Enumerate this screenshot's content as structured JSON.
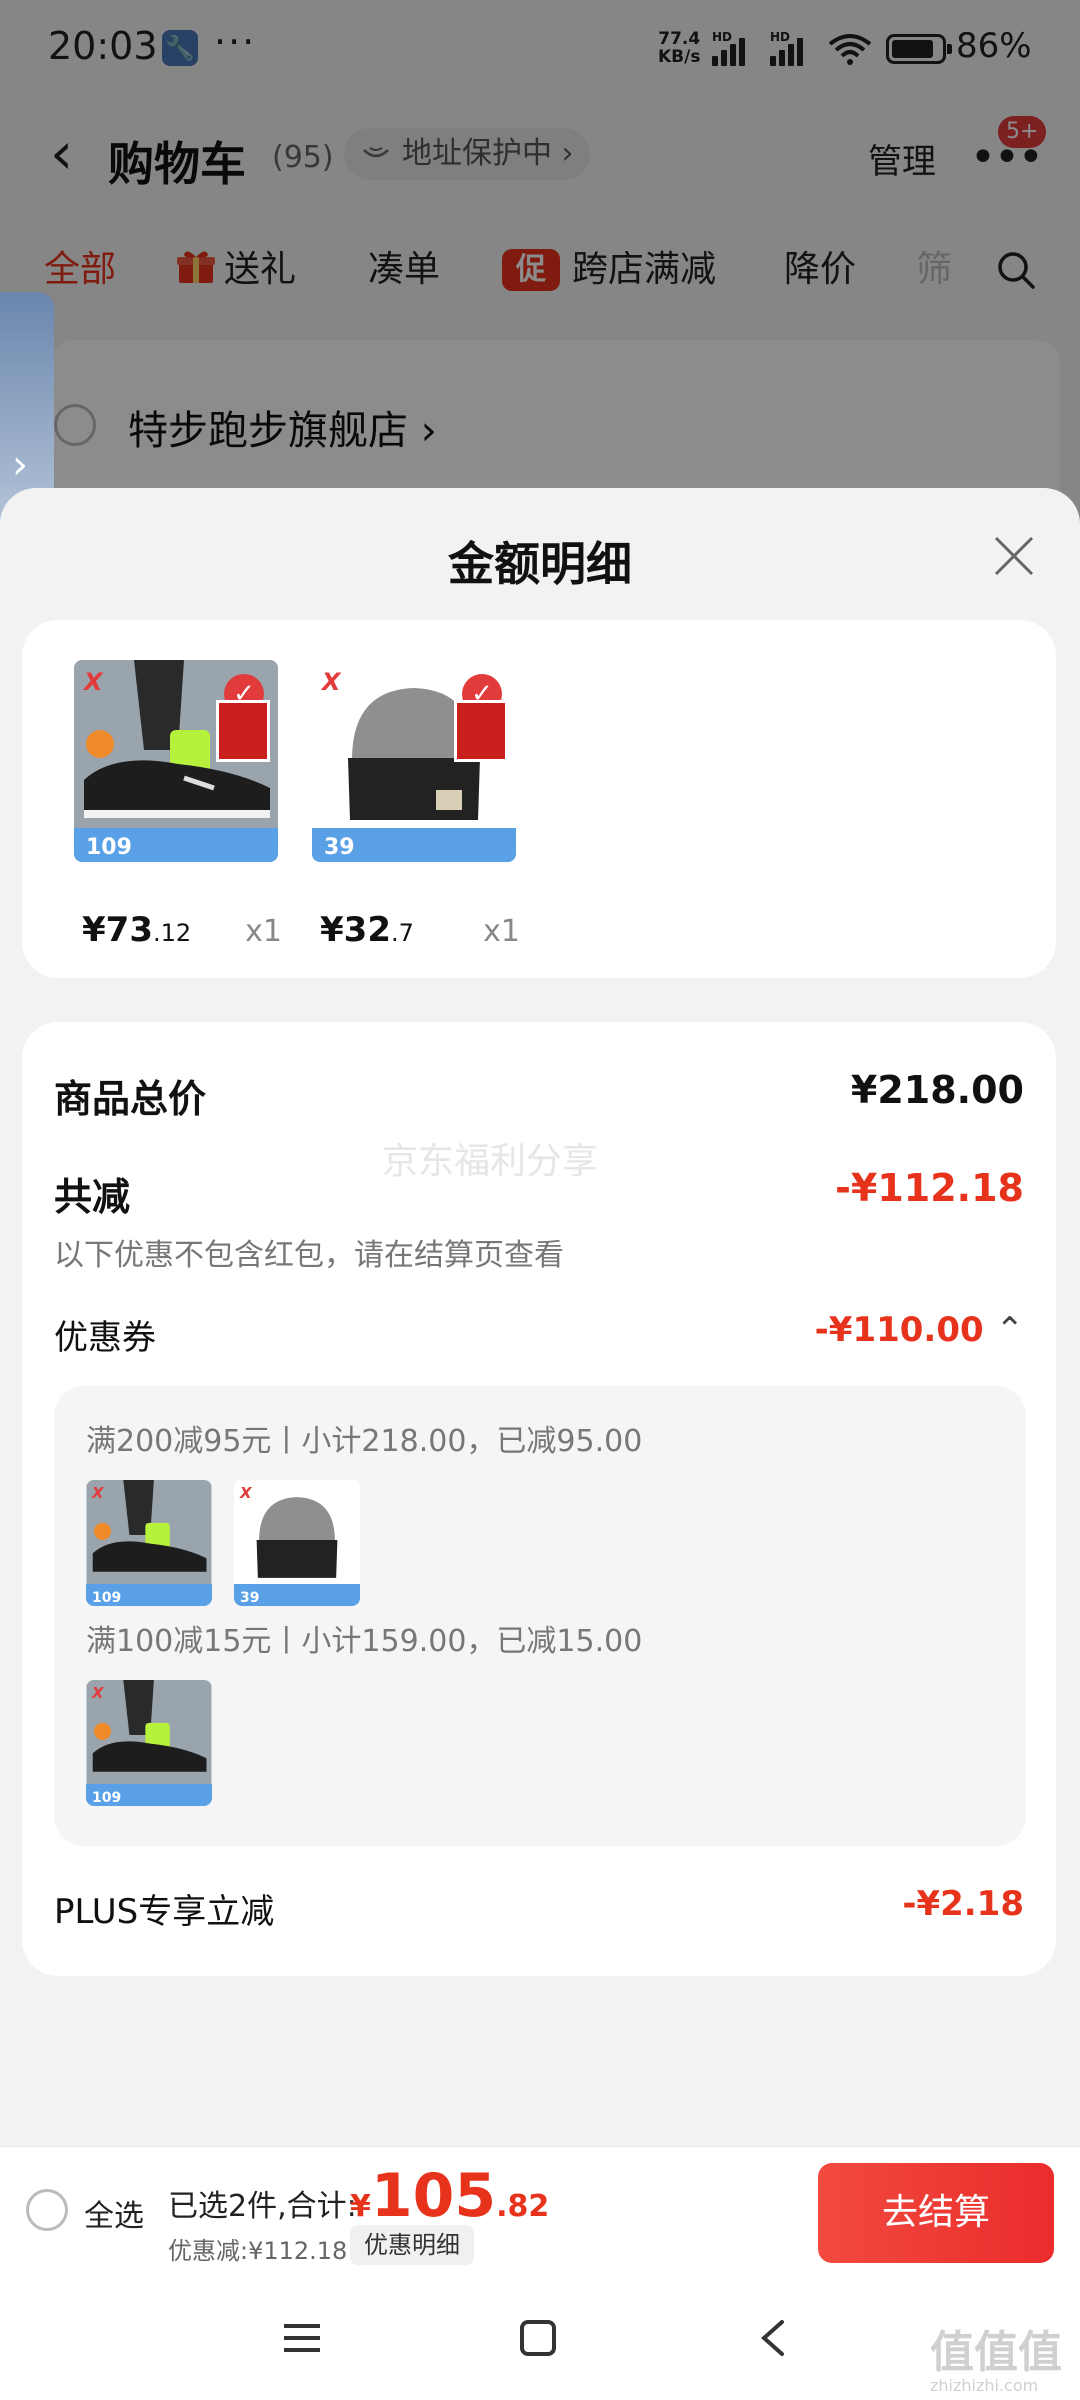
{
  "status_bar": {
    "time": "20:03",
    "dots": "···",
    "net_speed_value": "77.4",
    "net_speed_unit": "KB/s",
    "hd1": "HD",
    "hd2": "HD",
    "wifi_num": "6",
    "battery_percent": "86%",
    "battery_level": 0.86
  },
  "header": {
    "back_icon": "chevron-left-icon",
    "title": "购物车",
    "count": "(95)",
    "address_protect": "地址保护中",
    "manage": "管理",
    "more_badge": "5+"
  },
  "tabs": [
    {
      "label": "全部",
      "active": true
    },
    {
      "label": "送礼",
      "icon": "gift-icon"
    },
    {
      "label": "凑单"
    },
    {
      "label": "跨店满减",
      "icon": "促"
    },
    {
      "label": "降价"
    },
    {
      "label": "筛"
    }
  ],
  "store": {
    "name": "特步跑步旗舰店"
  },
  "sheet": {
    "title": "金额明细",
    "products": [
      {
        "name": "sneaker",
        "price_int": "¥73",
        "price_dec": ".12",
        "qty": "x1",
        "tag": "109",
        "brand": "X"
      },
      {
        "name": "knit-hat",
        "price_int": "¥32",
        "price_dec": ".7",
        "qty": "x1",
        "tag": "39",
        "brand": "X"
      }
    ],
    "total_label": "商品总价",
    "total_value": "¥218.00",
    "watermark": "京东福利分享",
    "reduce_label": "共减",
    "reduce_value": "-¥112.18",
    "reduce_note": "以下优惠不包含红包，请在结算页查看",
    "coupon_label": "优惠券",
    "coupon_value": "-¥110.00",
    "coupon_groups": [
      {
        "text": "满200减95元丨小计218.00，已减95.00",
        "items": [
          "109",
          "39"
        ]
      },
      {
        "text": "满100减15元丨小计159.00，已减15.00",
        "items": [
          "109"
        ]
      }
    ],
    "plus_label": "PLUS专享立减",
    "plus_value": "-¥2.18"
  },
  "bottom_bar": {
    "select_all": "全选",
    "summary": "已选2件,合计:",
    "currency": "¥",
    "total_int": "105",
    "total_dec": ".82",
    "discount": "优惠减:¥112.18",
    "detail_chip": "优惠明细",
    "checkout": "去结算"
  },
  "watermark_brand": {
    "text": "值值值",
    "sub": "zhizhizhi.com"
  },
  "colors": {
    "accent": "#e8331c",
    "checkout_bg": "#ee3b36"
  }
}
